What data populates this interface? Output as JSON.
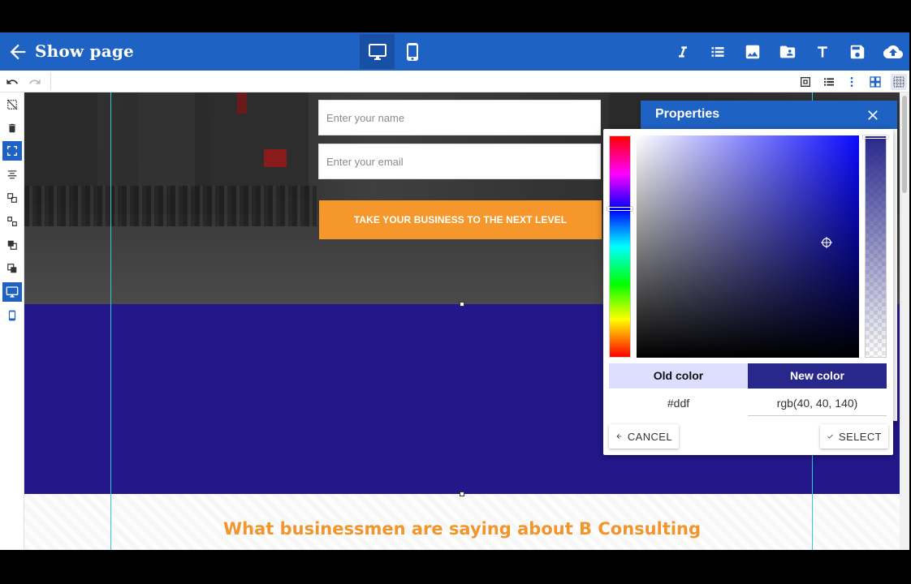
{
  "header": {
    "title": "Show page"
  },
  "form": {
    "name_placeholder": "Enter your name",
    "email_placeholder": "Enter your email",
    "cta_label": "TAKE YOUR BUSINESS TO THE NEXT LEVEL"
  },
  "testimonials": {
    "title": "What businessmen are saying about B Consulting"
  },
  "properties": {
    "title": "Properties"
  },
  "color_picker": {
    "old_label": "Old color",
    "new_label": "New color",
    "old_value": "#ddf",
    "new_value": "rgb(40, 40, 140)",
    "cancel_label": "CANCEL",
    "select_label": "SELECT",
    "old_color": "#ddddff",
    "new_color": "#28288c"
  },
  "colors": {
    "header": "#1e63c4",
    "accent": "#f5972a",
    "band": "#23188a",
    "guide": "#33c8e0"
  }
}
